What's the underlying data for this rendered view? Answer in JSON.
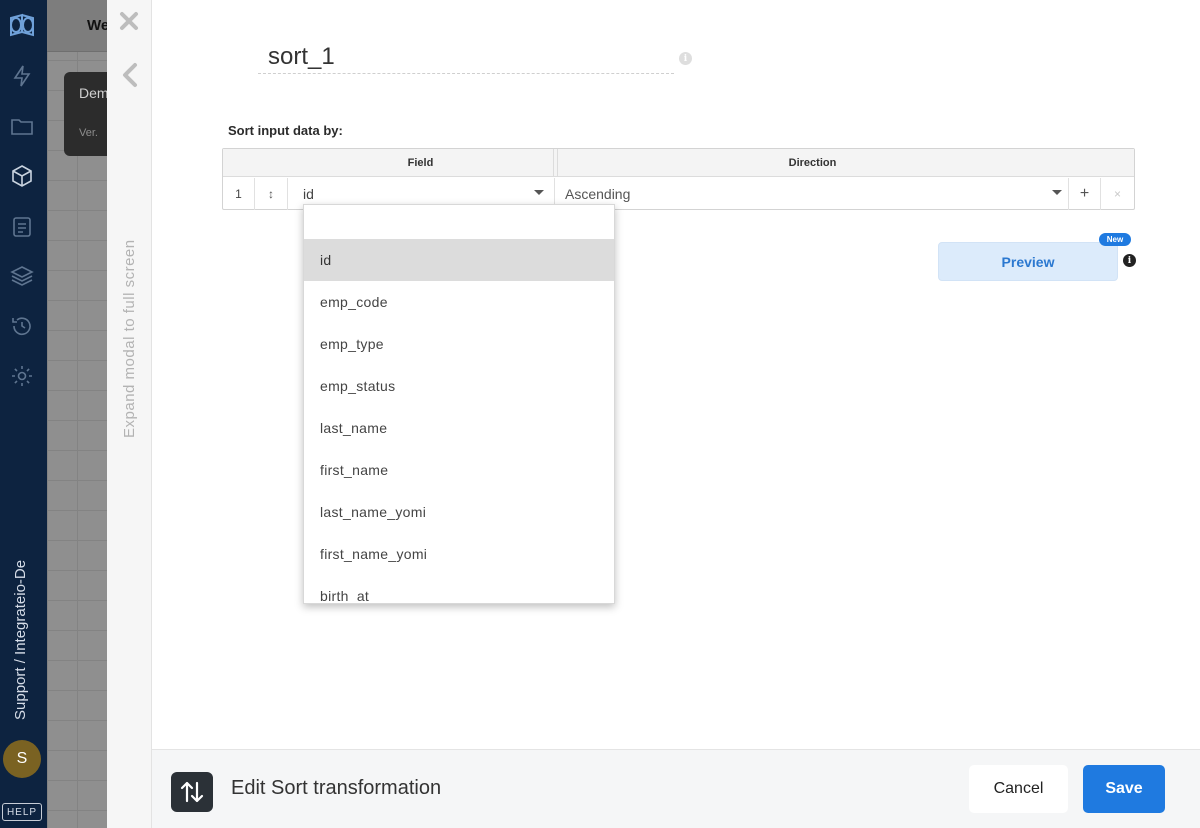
{
  "sidebar": {
    "workspace_path": "Support / Integrateio-De",
    "avatar_initial": "S",
    "help_label": "HELP",
    "icons": [
      "logo-icon",
      "bolt-icon",
      "folder-icon",
      "package-icon",
      "clipboard-icon",
      "layers-icon",
      "history-icon",
      "gear-icon"
    ]
  },
  "background": {
    "header_text": "We",
    "card_title": "Dem",
    "card_version": "Ver. "
  },
  "modal": {
    "expand_text": "Expand modal to full screen",
    "component_name": "sort_1",
    "sort_label": "Sort input data by:",
    "table": {
      "columns": [
        "Field",
        "Direction"
      ],
      "rows": [
        {
          "index": "1",
          "drag_handle": "↕",
          "field": "id",
          "direction": "Ascending"
        }
      ],
      "add_label": "+",
      "remove_label": "×"
    },
    "dropdown": {
      "search_value": "",
      "selected": "id",
      "options": [
        "id",
        "emp_code",
        "emp_type",
        "emp_status",
        "last_name",
        "first_name",
        "last_name_yomi",
        "first_name_yomi",
        "birth_at"
      ]
    },
    "preview": {
      "label": "Preview",
      "badge": "New"
    }
  },
  "footer": {
    "title": "Edit Sort transformation",
    "cancel_label": "Cancel",
    "save_label": "Save"
  },
  "colors": {
    "sidebar_bg": "#0d2340",
    "accent": "#1f7ae0",
    "preview_bg": "#dcebfb",
    "selected_option_bg": "#dcdcdc"
  }
}
